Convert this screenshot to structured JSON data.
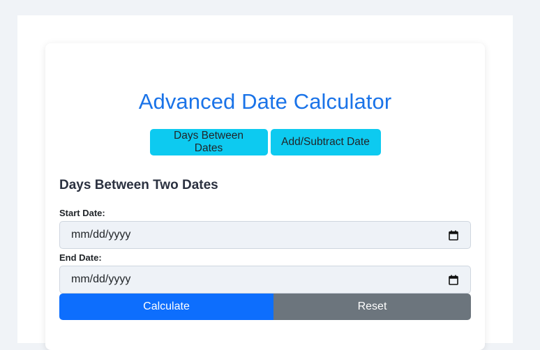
{
  "app": {
    "title": "Advanced Date Calculator"
  },
  "tabs": [
    {
      "label": "Days Between Dates"
    },
    {
      "label": "Add/Subtract Date"
    }
  ],
  "section": {
    "title": "Days Between Two Dates"
  },
  "form": {
    "start_label": "Start Date:",
    "start_placeholder": "mm/dd/yyyy",
    "end_label": "End Date:",
    "end_placeholder": "mm/dd/yyyy"
  },
  "actions": {
    "calculate_label": "Calculate",
    "reset_label": "Reset"
  },
  "colors": {
    "title": "#1a73e8",
    "tab_background": "#0dcaf0",
    "calculate_background": "#0d6efd",
    "reset_background": "#6c757d",
    "input_background": "#eef2f7",
    "page_background": "#f0f3f7"
  },
  "icons": {
    "date_picker": "calendar-icon"
  }
}
